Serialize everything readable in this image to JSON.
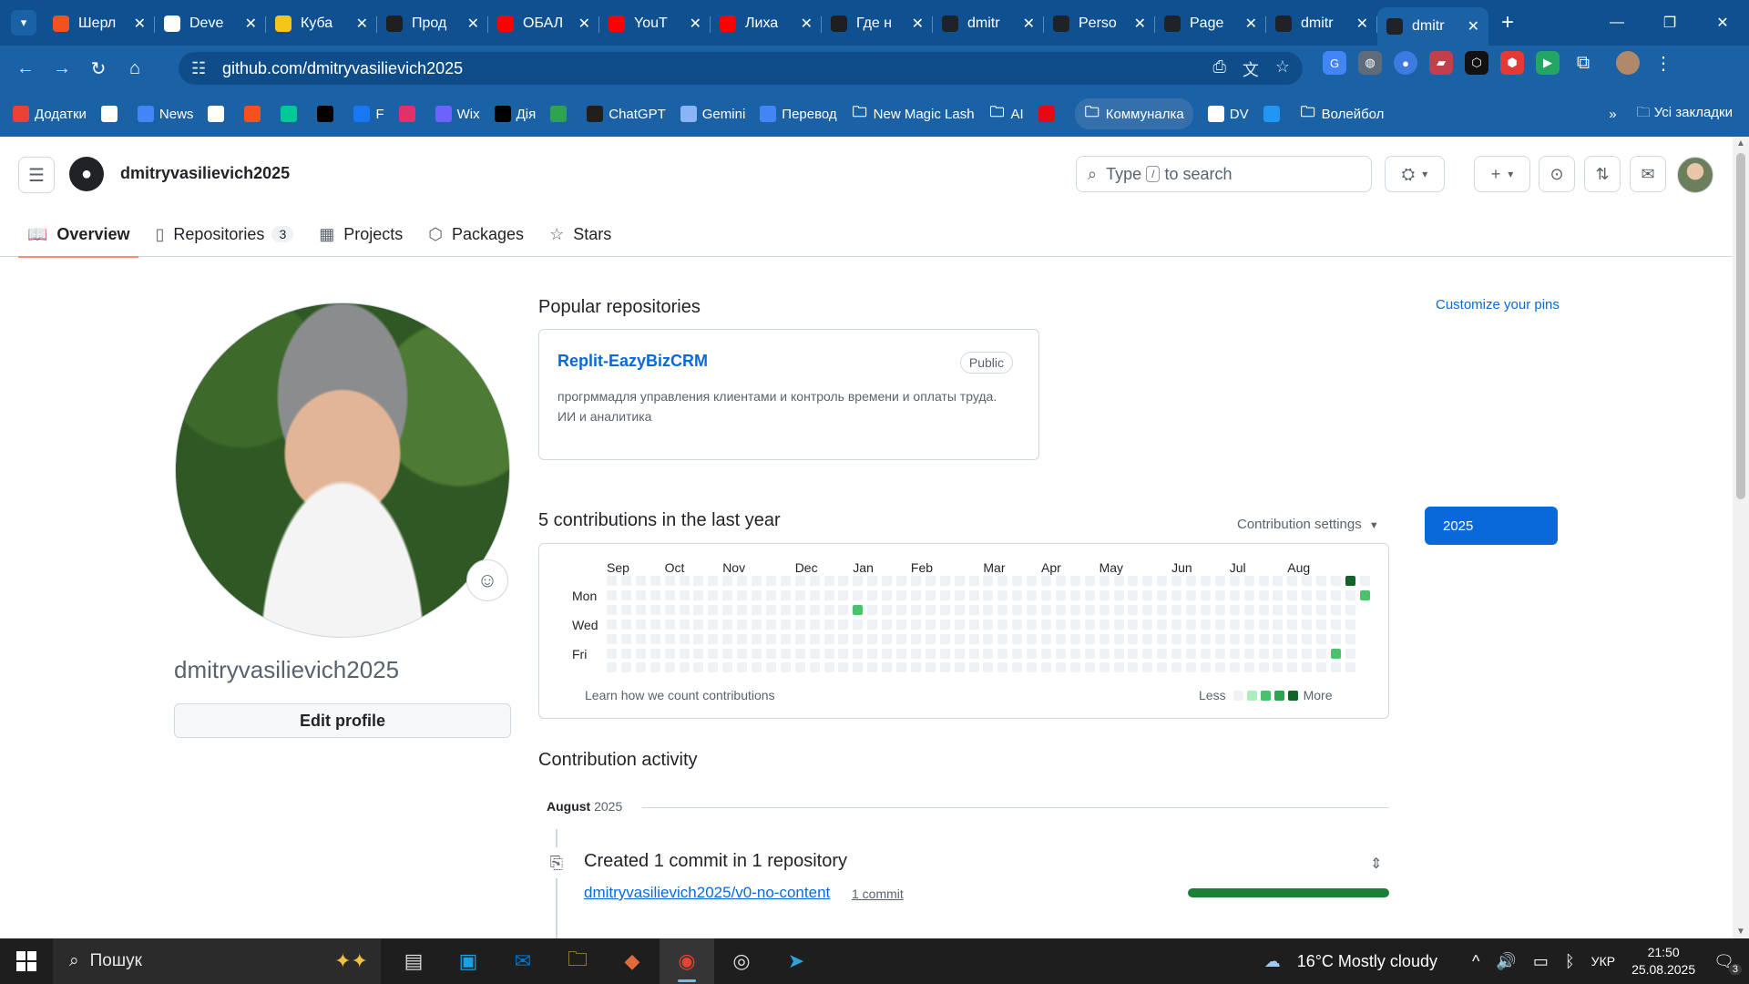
{
  "browser": {
    "tabs": [
      {
        "title": "Шерл",
        "icon": "orange-f-icon",
        "color": "#f4511e"
      },
      {
        "title": "Deve",
        "icon": "dev-icon",
        "color": "#ffffff"
      },
      {
        "title": "Куба",
        "icon": "emoji-icon",
        "color": "#f5c518"
      },
      {
        "title": "Прод",
        "icon": "openai-icon",
        "color": "#1f1f1f"
      },
      {
        "title": "ОБАЛ",
        "icon": "youtube-icon",
        "color": "#ff0000"
      },
      {
        "title": "YouT",
        "icon": "youtube-icon",
        "color": "#ff0000"
      },
      {
        "title": "Лиха",
        "icon": "youtube-icon",
        "color": "#ff0000"
      },
      {
        "title": "Где н",
        "icon": "openai-icon",
        "color": "#1f1f1f"
      },
      {
        "title": "dmitr",
        "icon": "github-icon",
        "color": "#1f2328"
      },
      {
        "title": "Perso",
        "icon": "github-icon",
        "color": "#1f2328"
      },
      {
        "title": "Page",
        "icon": "github-icon",
        "color": "#1f2328"
      },
      {
        "title": "dmitr",
        "icon": "github-icon",
        "color": "#1f2328"
      },
      {
        "title": "dmitr",
        "icon": "github-icon",
        "color": "#1f2328",
        "active": true
      }
    ],
    "url": "github.com/dmitryvasilievich2025",
    "bookmarks": [
      {
        "label": "Додатки",
        "icon": "apps-grid-icon",
        "color": "#e94235"
      },
      {
        "label": "",
        "icon": "grid-icon",
        "color": "#ffffff"
      },
      {
        "label": "News",
        "icon": "news-icon",
        "color": "#4285f4"
      },
      {
        "label": "",
        "icon": "a-icon",
        "color": "#ffffff"
      },
      {
        "label": "",
        "icon": "f-icon",
        "color": "#f4511e"
      },
      {
        "label": "",
        "icon": "ok-icon",
        "color": "#00c896"
      },
      {
        "label": "",
        "icon": "x-icon",
        "color": "#000000"
      },
      {
        "label": "F",
        "icon": "facebook-icon",
        "color": "#1877f2"
      },
      {
        "label": "",
        "icon": "instagram-icon",
        "color": "#e1306c"
      },
      {
        "label": "Wix",
        "icon": "shield-icon",
        "color": "#6c63ff"
      },
      {
        "label": "Дія",
        "icon": "diia-icon",
        "color": "#000000"
      },
      {
        "label": "",
        "icon": "green-square-icon",
        "color": "#2ea44f"
      },
      {
        "label": "ChatGPT",
        "icon": "openai-icon",
        "color": "#1f1f1f"
      },
      {
        "label": "Gemini",
        "icon": "gemini-icon",
        "color": "#8ab4f8"
      },
      {
        "label": "Перевод",
        "icon": "translate-icon",
        "color": "#4285f4"
      },
      {
        "label": "New Magic Lash",
        "icon": "folder-icon",
        "color": "#ffffff"
      },
      {
        "label": "AI",
        "icon": "folder-icon",
        "color": "#ffffff"
      },
      {
        "label": "",
        "icon": "netflix-icon",
        "color": "#e50914"
      },
      {
        "label": "Коммуналка",
        "icon": "folder-icon",
        "color": "#ffffff",
        "pill": true
      },
      {
        "label": "DV",
        "icon": "wix-icon",
        "color": "#ffffff"
      },
      {
        "label": "",
        "icon": "c-icon",
        "color": "#2196f3"
      },
      {
        "label": "Волейбол",
        "icon": "folder-icon",
        "color": "#ffffff"
      }
    ],
    "all_bookmarks": "Усі закладки"
  },
  "gh": {
    "username": "dmitryvasilievich2025",
    "search_prefix": "Type",
    "search_key": "/",
    "search_suffix": "to search",
    "tabs": [
      {
        "label": "Overview",
        "icon": "book-icon",
        "selected": true
      },
      {
        "label": "Repositories",
        "icon": "repo-icon",
        "count": "3"
      },
      {
        "label": "Projects",
        "icon": "table-icon"
      },
      {
        "label": "Packages",
        "icon": "package-icon"
      },
      {
        "label": "Stars",
        "icon": "star-icon"
      }
    ]
  },
  "profile": {
    "name": "dmitryvasilievich2025",
    "edit_label": "Edit profile"
  },
  "popular": {
    "title": "Popular repositories",
    "customize": "Customize your pins",
    "repo": {
      "name": "Replit-EazyBizCRM",
      "visibility": "Public",
      "description": "прогрммадля управления клиентами и контроль времени и оплаты труда. ИИ и аналитика"
    }
  },
  "contributions": {
    "title": "5 contributions in the last year",
    "settings": "Contribution settings",
    "year": "2025",
    "months": [
      "Sep",
      "Oct",
      "Nov",
      "Dec",
      "Jan",
      "Feb",
      "Mar",
      "Apr",
      "May",
      "Jun",
      "Jul",
      "Aug"
    ],
    "days": [
      "Mon",
      "Wed",
      "Fri"
    ],
    "learn_link": "Learn how we count contributions",
    "less": "Less",
    "more": "More",
    "level_colors": [
      "#eff2f5",
      "#aceebb",
      "#4ac26b",
      "#2da44e",
      "#116329"
    ],
    "active_cells": [
      {
        "week": 17,
        "day": 2,
        "level": 2
      },
      {
        "week": 50,
        "day": 5,
        "level": 2
      },
      {
        "week": 51,
        "day": 0,
        "level": 4
      },
      {
        "week": 52,
        "day": 1,
        "level": 2
      }
    ]
  },
  "activity": {
    "title": "Contribution activity",
    "month": "August",
    "year": "2025",
    "summary": "Created 1 commit in 1 repository",
    "repo": "dmitryvasilievich2025/v0-no-content",
    "commits": "1 commit"
  },
  "taskbar": {
    "search": "Пошук",
    "weather": "16°C  Mostly cloudy",
    "lang": "УКР",
    "time": "21:50",
    "date": "25.08.2025",
    "notif_count": "3"
  }
}
